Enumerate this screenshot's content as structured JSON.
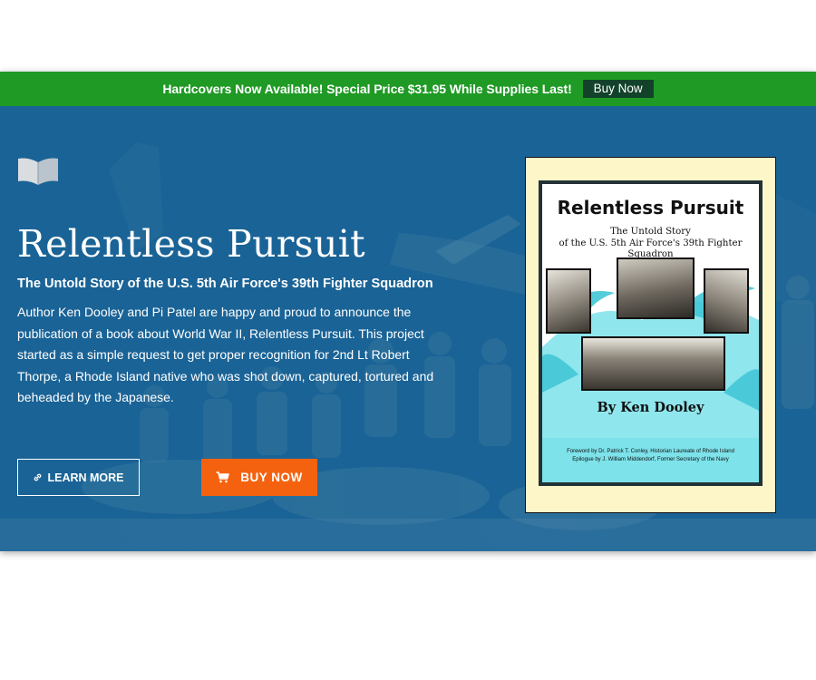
{
  "promo": {
    "text": "Hardcovers Now Available! Special Price $31.95 While Supplies Last!",
    "button_label": "Buy Now"
  },
  "hero": {
    "title": "Relentless Pursuit",
    "subtitle": "The Untold Story of the U.S. 5th Air Force's 39th Fighter Squadron",
    "body": "Author Ken Dooley and Pi Patel are happy and proud to announce the publication of a book about World War II, Relentless Pursuit. This project started as a simple request to get proper recognition for 2nd Lt Robert Thorpe, a Rhode Island native who was shot down, captured, tortured and beheaded by the Japanese.",
    "learn_more_label": "LEARN MORE",
    "buy_now_label": "BUY NOW",
    "learn_more_icon": "link-icon",
    "buy_now_icon": "cart-icon"
  },
  "book": {
    "title": "Relentless Pursuit",
    "subtitle_line1": "The Untold Story",
    "subtitle_line2": "of the U.S. 5th Air Force's 39th Fighter Squadron",
    "author": "By Ken Dooley",
    "foreword": "Foreword by Dr. Patrick T. Conley, Historian Laureate of Rhode Island",
    "epilogue": "Epilogue by J. William Middendorf, Former Secretary of the Navy"
  },
  "colors": {
    "promo_bar": "#1f9a25",
    "promo_button": "#13422a",
    "hero_background": "#1a6396",
    "buy_button": "#f5620f",
    "cover_frame": "#fdf6c9",
    "cover_accent": "#7de2ea"
  }
}
